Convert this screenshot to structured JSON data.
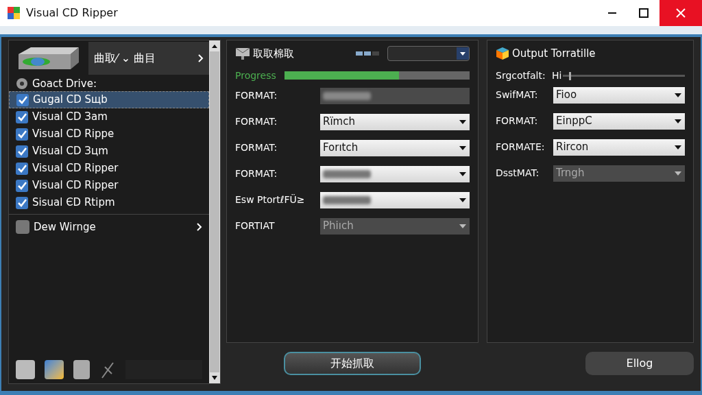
{
  "window": {
    "title": "Visual CD Ripper"
  },
  "sidebar": {
    "header": "曲取⁄ ⌄ 曲目",
    "drive_label": "Goact Drive:",
    "tracks": [
      {
        "label": "Gugal CD Sщb",
        "checked": true,
        "selected": true
      },
      {
        "label": "Visual CD Зam",
        "checked": true,
        "selected": false
      },
      {
        "label": "Visual CD Rippe",
        "checked": true,
        "selected": false
      },
      {
        "label": "Visual CD Зцm",
        "checked": true,
        "selected": false
      },
      {
        "label": "Visual CD Ripper",
        "checked": true,
        "selected": false
      },
      {
        "label": "Visual CD Ripper",
        "checked": true,
        "selected": false
      },
      {
        "label": "Sisual ЄD Rtipm",
        "checked": true,
        "selected": false
      }
    ],
    "footer_item": "Dew Wirnge"
  },
  "rip_panel": {
    "title": "取取棉取",
    "progress": {
      "label": "Progress",
      "level": 0.62
    },
    "rows": [
      {
        "label": "FORMAT:",
        "kind": "field",
        "disabled": true
      },
      {
        "label": "FORMAT:",
        "kind": "dropdown",
        "value": "Rïmch",
        "disabled": false
      },
      {
        "label": "FORMAT:",
        "kind": "dropdown",
        "value": "Forıtch",
        "disabled": false
      },
      {
        "label": "FORMAT:",
        "kind": "dropdown",
        "disabled": false
      },
      {
        "label": "Esw PtortℓFÜ≥",
        "kind": "dropdown",
        "disabled": false
      },
      {
        "label": "FORTIAT",
        "kind": "dropdown",
        "value": "Phiıch",
        "disabled": true
      }
    ]
  },
  "output_panel": {
    "title": "Output Torratille",
    "slider": {
      "label": "Srgcotfalt:",
      "value": "Hi",
      "level": 0.05
    },
    "rows": [
      {
        "label": "SwifMAT:",
        "value": "Fioo",
        "disabled": false
      },
      {
        "label": "FORMAT:",
        "value": "EinppC",
        "disabled": false
      },
      {
        "label": "FORMATE:",
        "value": "Rircon",
        "disabled": false
      },
      {
        "label": "DsstMAT:",
        "value": "Trngh",
        "disabled": true
      }
    ]
  },
  "buttons": {
    "start": "开始抓取",
    "log": "Ellog"
  }
}
